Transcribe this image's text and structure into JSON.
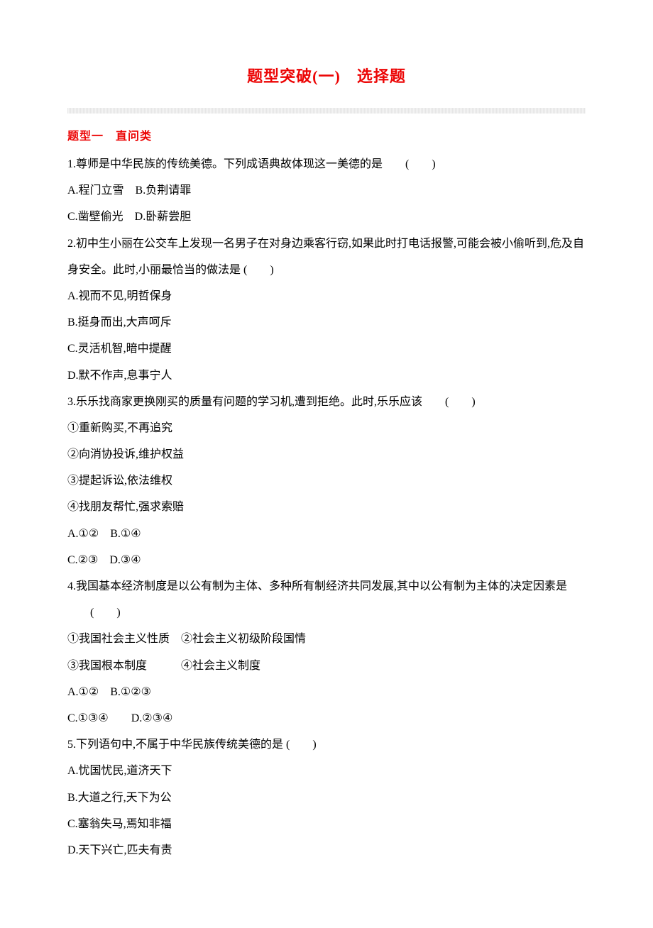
{
  "title": "题型突破(一)　选择题",
  "section_header": "题型一　直问类",
  "questions": {
    "q1": {
      "text": "1.尊师是中华民族的传统美德。下列成语典故体现这一美德的是　　(　　)",
      "optA": "A.程门立雪　B.负荆请罪",
      "optC": "C.凿壁偷光　D.卧薪尝胆"
    },
    "q2": {
      "line1": "2.初中生小丽在公交车上发现一名男子在对身边乘客行窃,如果此时打电话报警,可能会被小偷听到,危及自",
      "line2": "身安全。此时,小丽最恰当的做法是 (　　)",
      "optA": "A.视而不见,明哲保身",
      "optB": "B.挺身而出,大声呵斥",
      "optC": "C.灵活机智,暗中提醒",
      "optD": "D.默不作声,息事宁人"
    },
    "q3": {
      "text": "3.乐乐找商家更换刚买的质量有问题的学习机,遭到拒绝。此时,乐乐应该　　(　　)",
      "s1": "①重新购买,不再追究",
      "s2": "②向消协投诉,维护权益",
      "s3": "③提起诉讼,依法维权",
      "s4": "④找朋友帮忙,强求索赔",
      "optA": "A.①②　B.①④",
      "optC": "C.②③　D.③④"
    },
    "q4": {
      "line1": "4.我国基本经济制度是以公有制为主体、多种所有制经济共同发展,其中以公有制为主体的决定因素是",
      "line2": "(　　)",
      "s1": "①我国社会主义性质　②社会主义初级阶段国情",
      "s2": "③我国根本制度　　　④社会主义制度",
      "optA": "A.①②　B.①②③",
      "optC": "C.①③④　　D.②③④"
    },
    "q5": {
      "text": "5.下列语句中,不属于中华民族传统美德的是 (　　)",
      "optA": "A.忧国忧民,道济天下",
      "optB": "B.大道之行,天下为公",
      "optC": "C.塞翁失马,焉知非福",
      "optD": "D.天下兴亡,匹夫有责"
    }
  }
}
